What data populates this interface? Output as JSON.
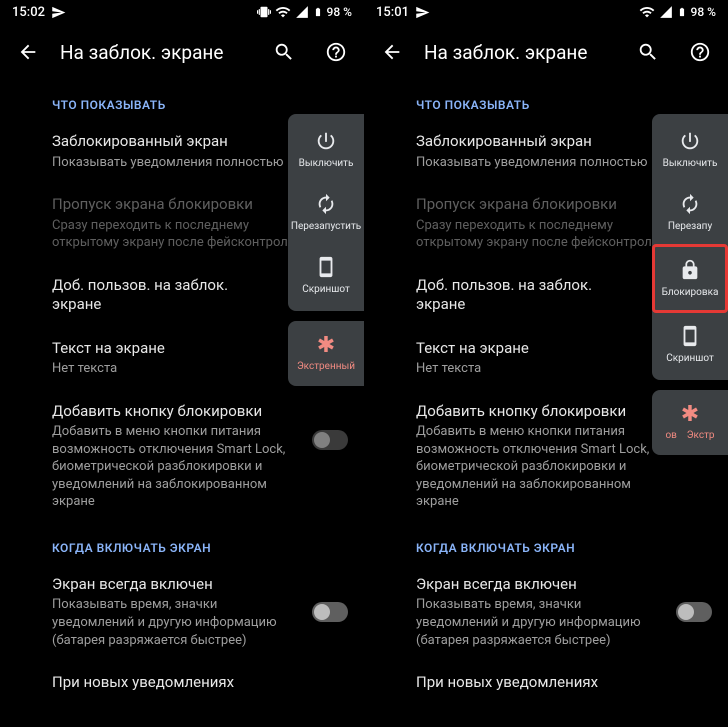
{
  "left": {
    "status": {
      "time": "15:02",
      "battery": "98 %"
    },
    "header": {
      "title": "На заблок. экране"
    },
    "section1": "ЧТО ПОКАЗЫВАТЬ",
    "s1": {
      "title": "Заблокированный экран",
      "sub": "Показывать уведомления полностью"
    },
    "s2": {
      "title": "Пропуск экрана блокировки",
      "sub": "Сразу переходить к последнему открытому экрану после фейсконтроля"
    },
    "s3": {
      "title": "Доб. пользов. на заблок. экране"
    },
    "s4": {
      "title": "Текст на экране",
      "sub": "Нет текста"
    },
    "s5": {
      "title": "Добавить кнопку блокировки",
      "sub": "Добавить в меню кнопки питания возможность отключения Smart Lock, биометрической разблокировки и уведомлений на заблокированном экране"
    },
    "section2": "КОГДА ВКЛЮЧАТЬ ЭКРАН",
    "s6": {
      "title": "Экран всегда включен",
      "sub": "Показывать время, значки уведомлений и другую информацию (батарея разряжается быстрее)"
    },
    "s7": {
      "title": "При новых уведомлениях"
    },
    "power_menu": {
      "power_off": "Выключить",
      "restart": "Перезапустить",
      "screenshot": "Скриншот",
      "emergency": "Экстренный"
    }
  },
  "right": {
    "status": {
      "time": "15:01",
      "battery": "98 %"
    },
    "header": {
      "title": "На заблок. экране"
    },
    "section1": "ЧТО ПОКАЗЫВАТЬ",
    "s1": {
      "title": "Заблокированный экран",
      "sub": "Показывать уведомления полностью"
    },
    "s2": {
      "title": "Пропуск экрана блокировки",
      "sub": "Сразу переходить к последнему открытому экрану после фейсконтроля"
    },
    "s3": {
      "title": "Доб. пользов. на заблок. экране"
    },
    "s4": {
      "title": "Текст на экране",
      "sub": "Нет текста"
    },
    "s5": {
      "title": "Добавить кнопку блокировки",
      "sub": "Добавить в меню кнопки питания возможность отключения Smart Lock, биометрической разблокировки и уведомлений на заблокированном экране"
    },
    "section2": "КОГДА ВКЛЮЧАТЬ ЭКРАН",
    "s6": {
      "title": "Экран всегда включен",
      "sub": "Показывать время, значки уведомлений и другую информацию (батарея разряжается быстрее)"
    },
    "s7": {
      "title": "При новых уведомлениях"
    },
    "power_menu": {
      "power_off": "Выключить",
      "restart": "Перезапу",
      "lockdown": "Блокировка",
      "screenshot": "Скриншот",
      "emergency_partial": "ов    Экстр"
    }
  }
}
